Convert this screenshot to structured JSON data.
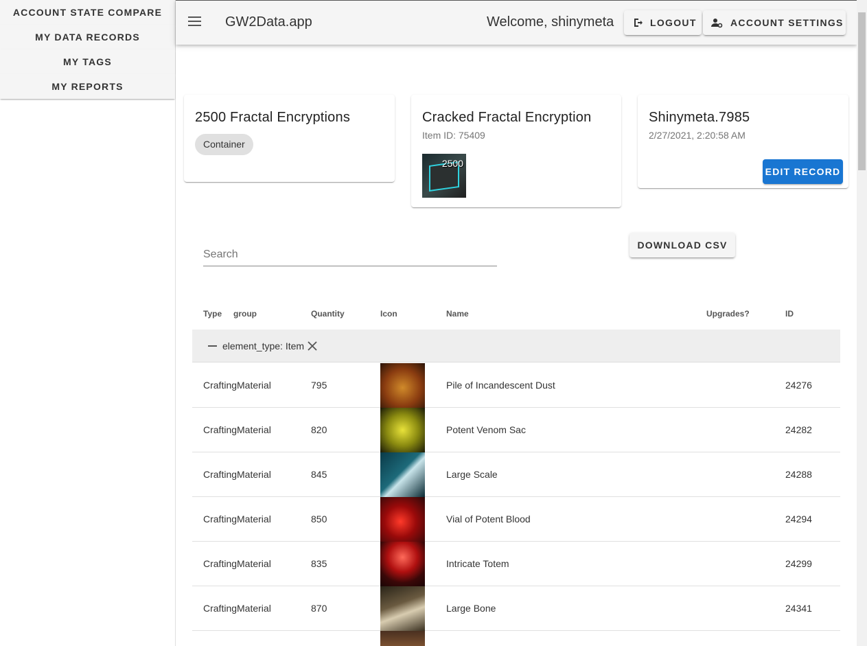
{
  "sidebar": {
    "items": [
      {
        "label": "ACCOUNT STATE COMPARE"
      },
      {
        "label": "MY DATA RECORDS"
      },
      {
        "label": "MY TAGS"
      },
      {
        "label": "MY REPORTS"
      }
    ]
  },
  "header": {
    "title": "GW2Data.app",
    "welcome": "Welcome, shinymeta",
    "logout_label": "LOGOUT",
    "account_settings_label": "ACCOUNT SETTINGS"
  },
  "cards": {
    "record": {
      "title": "2500 Fractal Encryptions",
      "chip": "Container"
    },
    "item": {
      "title": "Cracked Fractal Encryption",
      "subtitle": "Item ID: 75409",
      "icon_count": "2500",
      "icon": "fractal-encryption-icon"
    },
    "account": {
      "title": "Shinymeta.7985",
      "subtitle": "2/27/2021, 2:20:58 AM",
      "edit_label": "EDIT RECORD"
    }
  },
  "search": {
    "label": "Search"
  },
  "download_label": "DOWNLOAD CSV",
  "table": {
    "headers": {
      "type": "Type",
      "group": "group",
      "quantity": "Quantity",
      "icon": "Icon",
      "name": "Name",
      "upgrades": "Upgrades?",
      "id": "ID"
    },
    "group_label": "element_type: Item",
    "rows": [
      {
        "type": "CraftingMaterial",
        "quantity": "795",
        "name": "Pile of Incandescent Dust",
        "id": "24276",
        "icon": "dust-icon"
      },
      {
        "type": "CraftingMaterial",
        "quantity": "820",
        "name": "Potent Venom Sac",
        "id": "24282",
        "icon": "venom-sac-icon"
      },
      {
        "type": "CraftingMaterial",
        "quantity": "845",
        "name": "Large Scale",
        "id": "24288",
        "icon": "scale-icon"
      },
      {
        "type": "CraftingMaterial",
        "quantity": "850",
        "name": "Vial of Potent Blood",
        "id": "24294",
        "icon": "blood-vial-icon"
      },
      {
        "type": "CraftingMaterial",
        "quantity": "835",
        "name": "Intricate Totem",
        "id": "24299",
        "icon": "totem-icon"
      },
      {
        "type": "CraftingMaterial",
        "quantity": "870",
        "name": "Large Bone",
        "id": "24341",
        "icon": "bone-icon"
      }
    ]
  },
  "colors": {
    "primary": "#1976d2",
    "appbar": "#f5f5f5",
    "group_bg": "#eeeeee"
  }
}
